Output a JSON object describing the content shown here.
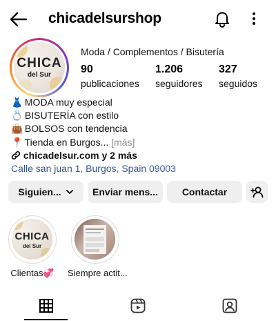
{
  "header": {
    "username": "chicadelsurshop",
    "back_icon": "arrow-left-icon",
    "bell_icon": "bell-icon",
    "more_icon": "more-vertical-icon"
  },
  "profile": {
    "avatar_logo_main": "CHICA",
    "avatar_logo_sub": "del Sur",
    "category": "Moda / Complementos / Bisutería",
    "stats": [
      {
        "value": "90",
        "label": "publicaciones"
      },
      {
        "value": "1.206",
        "label": "seguidores"
      },
      {
        "value": "327",
        "label": "seguidos"
      }
    ]
  },
  "bio": {
    "line1_icon": "👗",
    "line1": "MODA muy especial",
    "line2_icon": "💍",
    "line2": "BISUTERÍA con estilo",
    "line3_icon": "👜",
    "line3": "BOLSOS con tendencia",
    "line4_icon": "📍",
    "line4": "Tienda  en Burgos...",
    "more": "[más]",
    "link_icon": "link-icon",
    "link": "chicadelsur.com y 2 más",
    "location": "Calle san juan 1, Burgos, Spain 09003"
  },
  "actions": {
    "following": "Siguien...",
    "message": "Enviar mens...",
    "contact": "Contactar",
    "add_user_icon": "add-user-icon"
  },
  "highlights": [
    {
      "label": "Clientas💞",
      "logo_main": "CHICA",
      "logo_sub": "del Sur"
    },
    {
      "label": "Siempre actit..."
    }
  ],
  "tabs": [
    {
      "name": "grid",
      "icon": "grid-icon"
    },
    {
      "name": "reels",
      "icon": "reels-icon"
    },
    {
      "name": "tagged",
      "icon": "tagged-icon"
    }
  ],
  "colors": {
    "link": "#385898",
    "button_bg": "#efefef",
    "muted": "#8e8e8e"
  }
}
